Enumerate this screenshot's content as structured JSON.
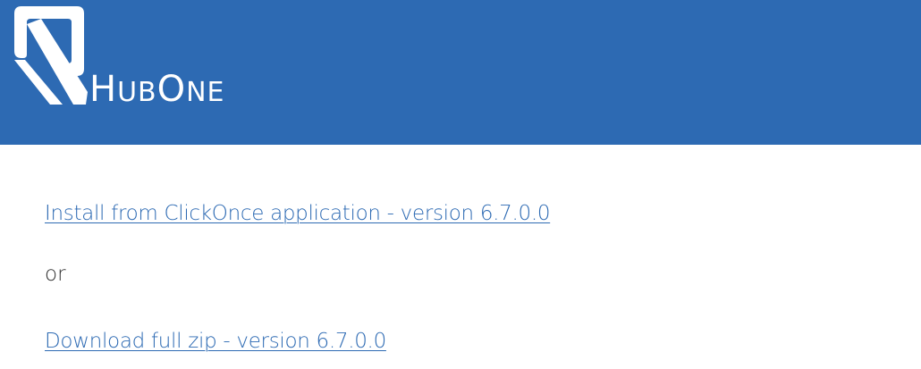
{
  "header": {
    "logo_text": "HubOne",
    "logo_parts": {
      "first_cap": "H",
      "first_rest": "UB",
      "second_cap": "O",
      "second_rest": "NE"
    },
    "background_color": "#2d6ab3"
  },
  "main": {
    "clickonce_link": "Install from ClickOnce application - version 6.7.0.0",
    "separator_text": "or",
    "zip_link": "Download full zip - version 6.7.0.0",
    "link_color": "#2d6ab3"
  }
}
